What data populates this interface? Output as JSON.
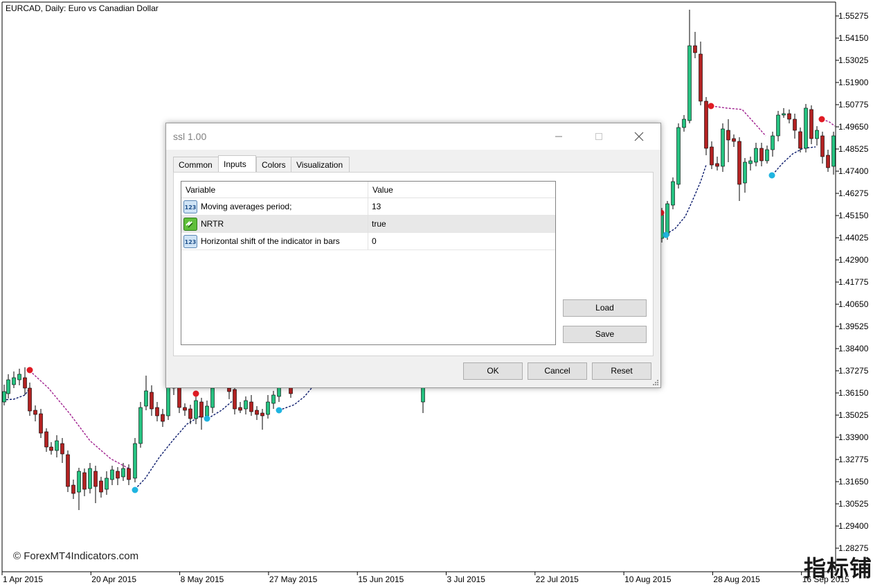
{
  "chart": {
    "title": "EURCAD, Daily:  Euro vs Canadian Dollar",
    "watermark": "© ForexMT4Indicators.com",
    "corner_mark": "指标铺",
    "price_labels": [
      "1.55275",
      "1.54150",
      "1.53025",
      "1.51900",
      "1.50775",
      "1.49650",
      "1.48525",
      "1.47400",
      "1.46275",
      "1.45150",
      "1.44025",
      "1.42900",
      "1.41775",
      "1.40650",
      "1.39525",
      "1.38400",
      "1.37275",
      "1.36150",
      "1.35025",
      "1.33900",
      "1.32775",
      "1.31650",
      "1.30525",
      "1.29400",
      "1.28275"
    ],
    "date_labels": [
      "1 Apr 2015",
      "20 Apr 2015",
      "8 May 2015",
      "27 May 2015",
      "15 Jun 2015",
      "3 Jul 2015",
      "22 Jul 2015",
      "10 Aug 2015",
      "28 Aug 2015",
      "16 Sep 2015"
    ],
    "colors": {
      "bull": "#26c281",
      "bear": "#b22222",
      "ssl_up": "#0a1a6b",
      "ssl_down": "#a0208f",
      "dot_up": "#1fb4e0",
      "dot_down": "#e01b24"
    }
  },
  "dialog": {
    "title": "ssl 1.00",
    "tabs": [
      "Common",
      "Inputs",
      "Colors",
      "Visualization"
    ],
    "active_tab": "Inputs",
    "columns": {
      "variable": "Variable",
      "value": "Value"
    },
    "rows": [
      {
        "icon": "numeric-123-icon",
        "variable": "Moving averages period;",
        "value": "13"
      },
      {
        "icon": "boolean-icon",
        "variable": "NRTR",
        "value": "true"
      },
      {
        "icon": "numeric-123-icon",
        "variable": "Horizontal shift of the indicator in bars",
        "value": "0"
      }
    ],
    "buttons": {
      "load": "Load",
      "save": "Save",
      "ok": "OK",
      "cancel": "Cancel",
      "reset": "Reset"
    }
  }
}
